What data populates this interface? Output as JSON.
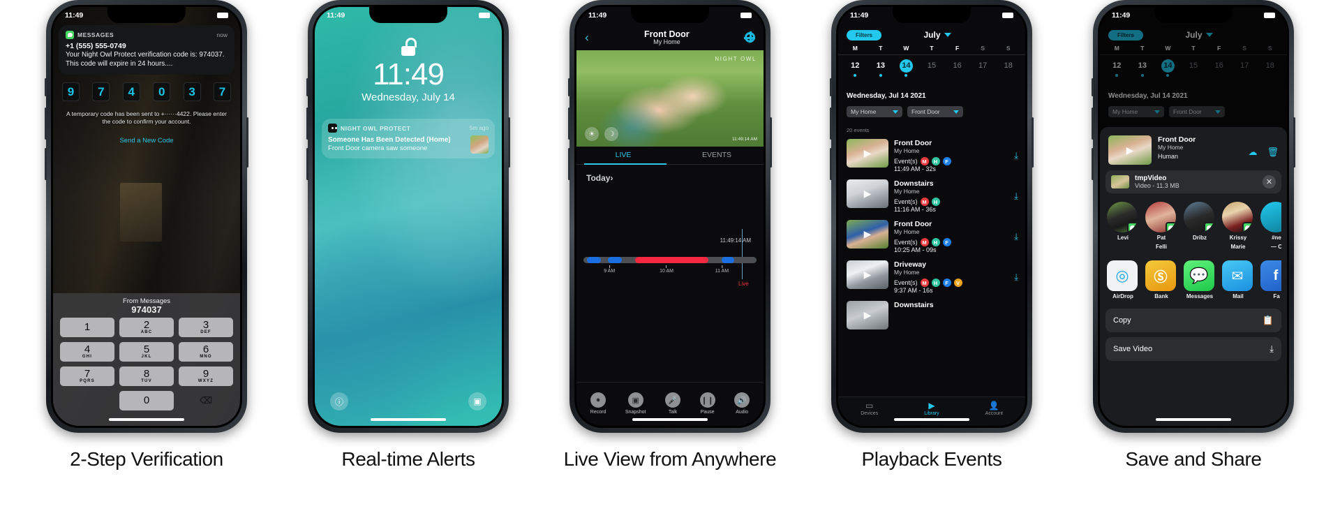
{
  "captions": [
    "2-Step Verification",
    "Real-time Alerts",
    "Live View from Anywhere",
    "Playback Events",
    "Save and Share"
  ],
  "status_time": "11:49",
  "phone1": {
    "message": {
      "app": "MESSAGES",
      "time_ago": "now",
      "from": "+1 (555) 555-0749",
      "body": "Your Night Owl Protect verification code is: 974037. This code will expire in 24 hours...."
    },
    "code_digits": [
      "9",
      "7",
      "4",
      "0",
      "3",
      "7"
    ],
    "note": "A temporary code has been sent to +······4422. Please enter the code to confirm your account.",
    "resend_link": "Send a New Code",
    "keyboard": {
      "suggestion_label": "From Messages",
      "suggestion_value": "974037",
      "keys": [
        {
          "num": "1",
          "letters": ""
        },
        {
          "num": "2",
          "letters": "ABC"
        },
        {
          "num": "3",
          "letters": "DEF"
        },
        {
          "num": "4",
          "letters": "GHI"
        },
        {
          "num": "5",
          "letters": "JKL"
        },
        {
          "num": "6",
          "letters": "MNO"
        },
        {
          "num": "7",
          "letters": "PQRS"
        },
        {
          "num": "8",
          "letters": "TUV"
        },
        {
          "num": "9",
          "letters": "WXYZ"
        },
        {
          "num": "0",
          "letters": ""
        }
      ],
      "delete_icon": "⌫"
    }
  },
  "phone2": {
    "clock": "11:49",
    "date": "Wednesday, July 14",
    "lock_icon": "unlocked-padlock",
    "notification": {
      "app": "NIGHT OWL PROTECT",
      "time_ago": "5m ago",
      "title": "Someone Has Been Detected (Home)",
      "subtitle": "Front Door camera saw someone"
    },
    "bottom_left_icon": "flashlight-icon",
    "bottom_right_icon": "camera-icon"
  },
  "phone3": {
    "title": "Front Door",
    "subtitle": "My Home",
    "watermark": "NIGHT OWL",
    "video_timestamp": "11:49:14 AM",
    "tabs": [
      {
        "label": "LIVE",
        "active": true
      },
      {
        "label": "EVENTS",
        "active": false
      }
    ],
    "today_label": "Today",
    "today_chevron": "›",
    "timeline": {
      "current_time": "11:49:14 AM",
      "live_label": "Live",
      "ticks": [
        "9 AM",
        "10 AM",
        "11 AM"
      ],
      "segments": [
        {
          "start_pct": 2,
          "width_pct": 8,
          "color": "#1b6fe0"
        },
        {
          "start_pct": 14,
          "width_pct": 8,
          "color": "#1b6fe0"
        },
        {
          "start_pct": 30,
          "width_pct": 42,
          "color": "#f4283f"
        },
        {
          "start_pct": 80,
          "width_pct": 7,
          "color": "#1b6fe0"
        }
      ]
    },
    "toolbar": [
      {
        "label": "Record",
        "icon": "record-icon",
        "glyph": "●"
      },
      {
        "label": "Snapshot",
        "icon": "snapshot-icon",
        "glyph": "▣"
      },
      {
        "label": "Talk",
        "icon": "microphone-icon",
        "glyph": "⬤"
      },
      {
        "label": "Pause",
        "icon": "pause-icon",
        "glyph": "❙❙"
      },
      {
        "label": "Audio",
        "icon": "speaker-icon",
        "glyph": "◀"
      }
    ]
  },
  "phone4": {
    "filters_label": "Filters",
    "month": "July",
    "dow": [
      "M",
      "T",
      "W",
      "T",
      "F",
      "S",
      "S"
    ],
    "days": [
      {
        "num": "12",
        "dim": false,
        "dot": true,
        "selected": false
      },
      {
        "num": "13",
        "dim": false,
        "dot": true,
        "selected": false
      },
      {
        "num": "14",
        "dim": false,
        "dot": true,
        "selected": true
      },
      {
        "num": "15",
        "dim": true,
        "dot": false,
        "selected": false
      },
      {
        "num": "16",
        "dim": true,
        "dot": false,
        "selected": false
      },
      {
        "num": "17",
        "dim": true,
        "dot": false,
        "selected": false
      },
      {
        "num": "18",
        "dim": true,
        "dot": false,
        "selected": false
      }
    ],
    "date_header": "Wednesday, Jul 14 2021",
    "filter_home": "My Home",
    "filter_camera": "Front Door",
    "event_count": "20 events",
    "event_label": "Event(s)",
    "events": [
      {
        "name": "Front Door",
        "location": "My Home",
        "time": "11:49 AM - 32s",
        "badges": [
          {
            "l": "M",
            "c": "#e8393c"
          },
          {
            "l": "H",
            "c": "#2fc5a0"
          },
          {
            "l": "F",
            "c": "#1f7fe8"
          }
        ]
      },
      {
        "name": "Downstairs",
        "location": "My Home",
        "time": "11:16 AM - 36s",
        "badges": [
          {
            "l": "M",
            "c": "#e8393c"
          },
          {
            "l": "H",
            "c": "#2fc5a0"
          }
        ]
      },
      {
        "name": "Front Door",
        "location": "My Home",
        "time": "10:25 AM - 09s",
        "badges": [
          {
            "l": "M",
            "c": "#e8393c"
          },
          {
            "l": "H",
            "c": "#2fc5a0"
          },
          {
            "l": "F",
            "c": "#1f7fe8"
          }
        ]
      },
      {
        "name": "Driveway",
        "location": "My Home",
        "time": "9:37 AM - 16s",
        "badges": [
          {
            "l": "M",
            "c": "#e8393c"
          },
          {
            "l": "H",
            "c": "#2fc5a0"
          },
          {
            "l": "F",
            "c": "#1f7fe8"
          },
          {
            "l": "V",
            "c": "#f0a31e"
          }
        ]
      },
      {
        "name": "Downstairs",
        "location": "My Home",
        "time": "",
        "badges": []
      }
    ],
    "tabbar": [
      {
        "label": "Devices",
        "icon": "devices-icon",
        "glyph": "▭",
        "active": false
      },
      {
        "label": "Library",
        "icon": "library-play-icon",
        "glyph": "▶",
        "active": true
      },
      {
        "label": "Account",
        "icon": "account-icon",
        "glyph": "⬤",
        "active": false
      }
    ],
    "download_icon": "download-icon"
  },
  "phone5": {
    "header": {
      "name": "Front Door",
      "location": "My Home",
      "type": "Human",
      "cloud_icon": "cloud-upload-icon",
      "trash_icon": "trash-icon"
    },
    "file": {
      "name": "tmpVideo",
      "meta": "Video - 11.3 MB",
      "close_icon": "close-icon"
    },
    "people": [
      {
        "name": "Levi",
        "name2": "",
        "badge": "messages-badge"
      },
      {
        "name": "Pat",
        "name2": "Felli",
        "badge": "messages-badge"
      },
      {
        "name": "Dribz",
        "name2": "",
        "badge": "messages-badge"
      },
      {
        "name": "Krissy",
        "name2": "Marie",
        "badge": "messages-badge"
      },
      {
        "name": "#ne",
        "name2": "— C",
        "badge": "messages-badge"
      }
    ],
    "apps": [
      {
        "label": "AirDrop",
        "icon": "airdrop-icon"
      },
      {
        "label": "Bank",
        "icon": "bank-icon"
      },
      {
        "label": "Messages",
        "icon": "messages-icon"
      },
      {
        "label": "Mail",
        "icon": "mail-icon"
      },
      {
        "label": "Fa",
        "icon": "facebook-icon"
      }
    ],
    "actions": [
      {
        "label": "Copy",
        "icon": "copy-icon",
        "glyph": "❐"
      },
      {
        "label": "Save Video",
        "icon": "save-video-icon",
        "glyph": "⤓"
      }
    ]
  }
}
